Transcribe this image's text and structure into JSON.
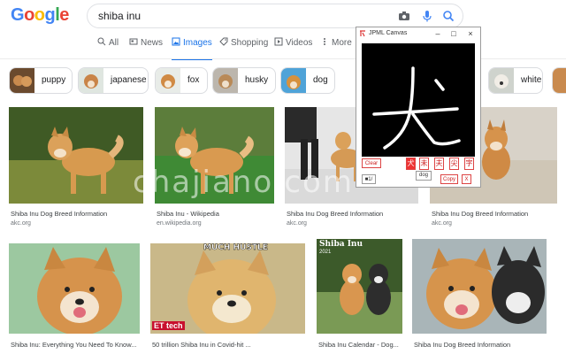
{
  "search": {
    "query": "shiba inu",
    "logo": "Google"
  },
  "tabs": [
    {
      "label": "All",
      "icon": "search-icon"
    },
    {
      "label": "News",
      "icon": "news-icon"
    },
    {
      "label": "Images",
      "icon": "image-icon"
    },
    {
      "label": "Shopping",
      "icon": "tag-icon"
    },
    {
      "label": "Videos",
      "icon": "play-icon"
    },
    {
      "label": "More",
      "icon": "more-icon"
    }
  ],
  "chips": [
    "puppy",
    "japanese",
    "fox",
    "husky",
    "dog",
    "white"
  ],
  "results": [
    {
      "caption": "Shiba Inu Dog Breed Information",
      "source": "akc.org"
    },
    {
      "caption": "Shiba Inu - Wikipedia",
      "source": "en.wikipedia.org"
    },
    {
      "caption": "Shiba Inu Dog Breed Information",
      "source": "akc.org"
    },
    {
      "caption": "Shiba Inu Dog Breed Information",
      "source": "akc.org"
    },
    {
      "caption": "Shiba Inu: Everything You Need To Know...",
      "source": ""
    },
    {
      "caption": "50 trillion Shiba Inu in Covid-hit ...",
      "source": ""
    },
    {
      "caption": "Shiba Inu Calendar - Dog...",
      "source": ""
    },
    {
      "caption": "Shiba Inu Dog Breed Information",
      "source": ""
    }
  ],
  "image_text": {
    "meme": "MUCH HUSTLE",
    "brand": "ET tech",
    "calendar": "Shiba Inu",
    "calendar_year": "2021"
  },
  "watermark": "chajiano.com",
  "jpml": {
    "title": "JPML Canvas",
    "clear": "Clear",
    "candidates": [
      "犬",
      "未",
      "夫",
      "尖",
      "字"
    ],
    "tooltip": "dog",
    "copy": "Copy",
    "x": "X",
    "misc": "■1/"
  },
  "colors": {
    "accent": "#1a73e8",
    "jpml_red": "#dd3333"
  }
}
